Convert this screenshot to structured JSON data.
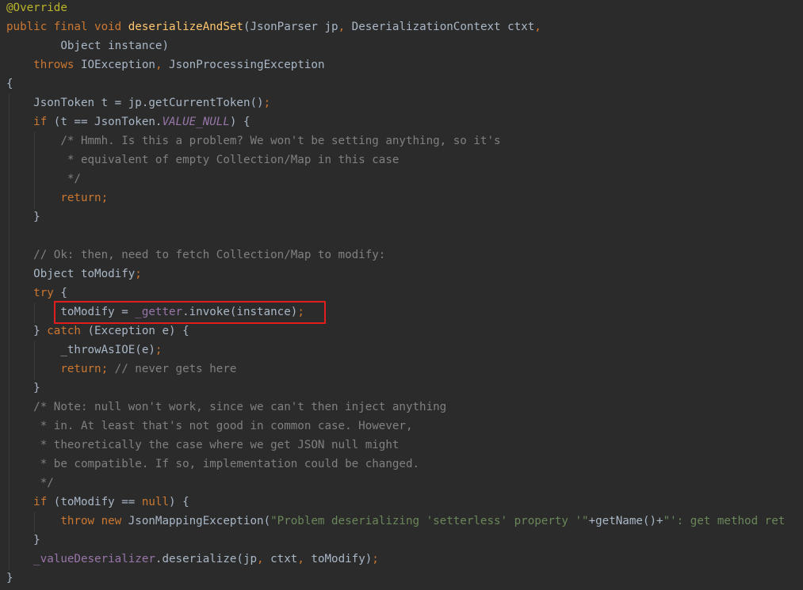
{
  "editor": {
    "lines": [
      {
        "tokens": [
          {
            "t": "@Override",
            "c": "annotation"
          }
        ]
      },
      {
        "tokens": [
          {
            "t": "public final void ",
            "c": "keyword"
          },
          {
            "t": "deserializeAndSet",
            "c": "method-decl"
          },
          {
            "t": "(JsonParser jp",
            "c": "plain"
          },
          {
            "t": ", ",
            "c": "punct"
          },
          {
            "t": "DeserializationContext ctxt",
            "c": "plain"
          },
          {
            "t": ",",
            "c": "punct"
          }
        ]
      },
      {
        "tokens": [
          {
            "t": "        Object instance)",
            "c": "plain"
          }
        ]
      },
      {
        "tokens": [
          {
            "t": "    throws ",
            "c": "keyword"
          },
          {
            "t": "IOException",
            "c": "plain"
          },
          {
            "t": ", ",
            "c": "punct"
          },
          {
            "t": "JsonProcessingException",
            "c": "plain"
          }
        ]
      },
      {
        "tokens": [
          {
            "t": "{",
            "c": "plain"
          }
        ]
      },
      {
        "tokens": [
          {
            "t": "    JsonToken t = jp.getCurrentToken()",
            "c": "plain"
          },
          {
            "t": ";",
            "c": "punct"
          }
        ]
      },
      {
        "tokens": [
          {
            "t": "    if ",
            "c": "keyword"
          },
          {
            "t": "(t == JsonToken.",
            "c": "plain"
          },
          {
            "t": "VALUE_NULL",
            "c": "static-field"
          },
          {
            "t": ") {",
            "c": "plain"
          }
        ]
      },
      {
        "tokens": [
          {
            "t": "        /* Hmmh. Is this a problem? We won't be setting anything, so it's",
            "c": "comment"
          }
        ]
      },
      {
        "tokens": [
          {
            "t": "         * equivalent of empty Collection/Map in this case",
            "c": "comment"
          }
        ]
      },
      {
        "tokens": [
          {
            "t": "         */",
            "c": "comment"
          }
        ]
      },
      {
        "tokens": [
          {
            "t": "        return;",
            "c": "keyword"
          }
        ]
      },
      {
        "tokens": [
          {
            "t": "    }",
            "c": "plain"
          }
        ]
      },
      {
        "tokens": []
      },
      {
        "tokens": [
          {
            "t": "    // Ok: then, need to fetch Collection/Map to modify:",
            "c": "comment"
          }
        ]
      },
      {
        "tokens": [
          {
            "t": "    Object toModify",
            "c": "plain"
          },
          {
            "t": ";",
            "c": "punct"
          }
        ]
      },
      {
        "tokens": [
          {
            "t": "    try ",
            "c": "keyword"
          },
          {
            "t": "{",
            "c": "plain"
          }
        ]
      },
      {
        "tokens": [
          {
            "t": "        toModify = ",
            "c": "plain"
          },
          {
            "t": "_getter",
            "c": "field"
          },
          {
            "t": ".invoke(instance)",
            "c": "plain"
          },
          {
            "t": ";",
            "c": "punct"
          }
        ]
      },
      {
        "tokens": [
          {
            "t": "    } ",
            "c": "plain"
          },
          {
            "t": "catch ",
            "c": "keyword"
          },
          {
            "t": "(Exception e) {",
            "c": "plain"
          }
        ]
      },
      {
        "tokens": [
          {
            "t": "        _throwAsIOE(e)",
            "c": "plain"
          },
          {
            "t": ";",
            "c": "punct"
          }
        ]
      },
      {
        "tokens": [
          {
            "t": "        return; ",
            "c": "keyword"
          },
          {
            "t": "// never gets here",
            "c": "comment"
          }
        ]
      },
      {
        "tokens": [
          {
            "t": "    }",
            "c": "plain"
          }
        ]
      },
      {
        "tokens": [
          {
            "t": "    /* Note: null won't work, since we can't then inject anything",
            "c": "comment"
          }
        ]
      },
      {
        "tokens": [
          {
            "t": "     * in. At least that's not good in common case. However,",
            "c": "comment"
          }
        ]
      },
      {
        "tokens": [
          {
            "t": "     * theoretically the case where we get JSON null might",
            "c": "comment"
          }
        ]
      },
      {
        "tokens": [
          {
            "t": "     * be compatible. If so, implementation could be changed.",
            "c": "comment"
          }
        ]
      },
      {
        "tokens": [
          {
            "t": "     */",
            "c": "comment"
          }
        ]
      },
      {
        "tokens": [
          {
            "t": "    if ",
            "c": "keyword"
          },
          {
            "t": "(toModify == ",
            "c": "plain"
          },
          {
            "t": "null",
            "c": "keyword"
          },
          {
            "t": ") {",
            "c": "plain"
          }
        ]
      },
      {
        "tokens": [
          {
            "t": "        throw new ",
            "c": "keyword"
          },
          {
            "t": "JsonMappingException(",
            "c": "plain"
          },
          {
            "t": "\"Problem deserializing 'setterless' property '\"",
            "c": "string"
          },
          {
            "t": "+getName()+",
            "c": "plain"
          },
          {
            "t": "\"': get method ret",
            "c": "string"
          }
        ]
      },
      {
        "tokens": [
          {
            "t": "    }",
            "c": "plain"
          }
        ]
      },
      {
        "tokens": [
          {
            "t": "    ",
            "c": "plain"
          },
          {
            "t": "_valueDeserializer",
            "c": "field"
          },
          {
            "t": ".deserialize(jp",
            "c": "plain"
          },
          {
            "t": ", ",
            "c": "punct"
          },
          {
            "t": "ctxt",
            "c": "plain"
          },
          {
            "t": ", ",
            "c": "punct"
          },
          {
            "t": "toModify)",
            "c": "plain"
          },
          {
            "t": ";",
            "c": "punct"
          }
        ]
      },
      {
        "tokens": [
          {
            "t": "}",
            "c": "plain"
          }
        ]
      }
    ],
    "colors": {
      "background": "#2b2b2b",
      "keyword": "#cc7832",
      "annotation": "#bbb529",
      "method_decl": "#ffc66d",
      "field": "#9876aa",
      "comment": "#808080",
      "string": "#6a8759",
      "plain": "#a9b7c6",
      "highlight_box": "#e01e1e"
    }
  }
}
